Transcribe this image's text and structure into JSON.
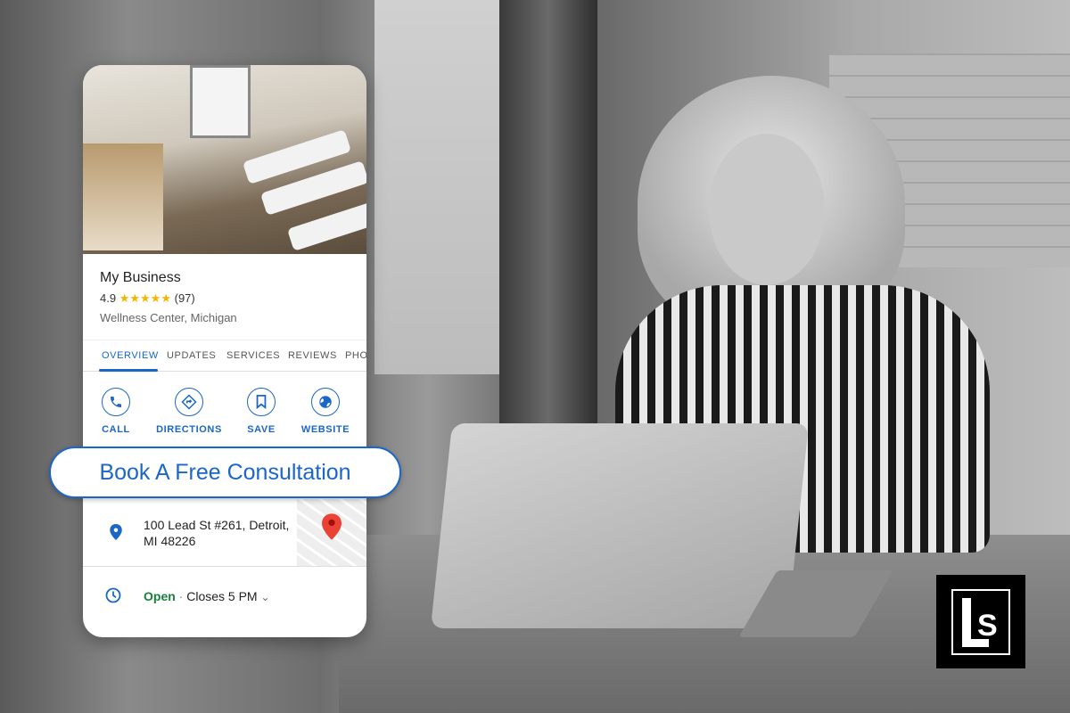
{
  "business": {
    "name": "My Business",
    "rating": "4.9",
    "stars": "★★★★★",
    "review_count": "(97)",
    "category": "Wellness Center, Michigan"
  },
  "tabs": [
    "OVERVIEW",
    "UPDATES",
    "SERVICES",
    "REVIEWS",
    "PHO"
  ],
  "active_tab": "OVERVIEW",
  "actions": [
    {
      "label": "CALL",
      "icon": "phone-icon"
    },
    {
      "label": "DIRECTIONS",
      "icon": "directions-icon"
    },
    {
      "label": "SAVE",
      "icon": "bookmark-icon"
    },
    {
      "label": "WEBSITE",
      "icon": "globe-icon"
    }
  ],
  "cta": "Book A Free Consultation",
  "address": {
    "line1": "100 Lead St #261, Detroit,",
    "line2": "MI 48226"
  },
  "hours": {
    "status": "Open",
    "separator": " · ",
    "closes": "Closes 5 PM",
    "chevron": "⌄"
  },
  "logo": {
    "text": "LS"
  },
  "colors": {
    "accent": "#1a66c9",
    "open": "#188038",
    "star": "#f4b400",
    "pin": "#ea4335"
  }
}
